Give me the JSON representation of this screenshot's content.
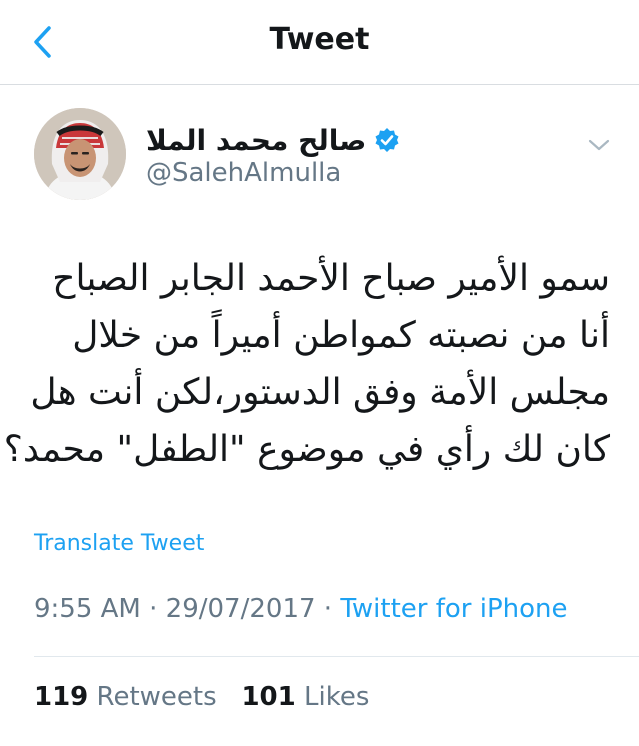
{
  "nav": {
    "title": "Tweet"
  },
  "author": {
    "display_name": "صالح محمد الملا",
    "handle": "@SalehAlmulla",
    "verified": true
  },
  "tweet": {
    "lines": [
      "سمو الأمير صباح الأحمد الجابر الصباح",
      "أنا من نصبته كمواطن أميراً من خلال",
      "مجلس الأمة وفق الدستور،لكن أنت هل",
      "كان لك رأي في موضوع \"الطفل\" محمد؟!"
    ],
    "translate_label": "Translate Tweet",
    "time": "9:55 AM",
    "date": "29/07/2017",
    "separator": "·",
    "source": "Twitter for iPhone"
  },
  "stats": {
    "retweets_count": "119",
    "retweets_label": "Retweets",
    "likes_count": "101",
    "likes_label": "Likes"
  },
  "colors": {
    "accent": "#1da1f2",
    "secondary_text": "#657786",
    "primary_text": "#14171a"
  },
  "icons": {
    "back": "chevron-left-icon",
    "verified": "verified-badge-icon",
    "more": "chevron-down-icon"
  }
}
